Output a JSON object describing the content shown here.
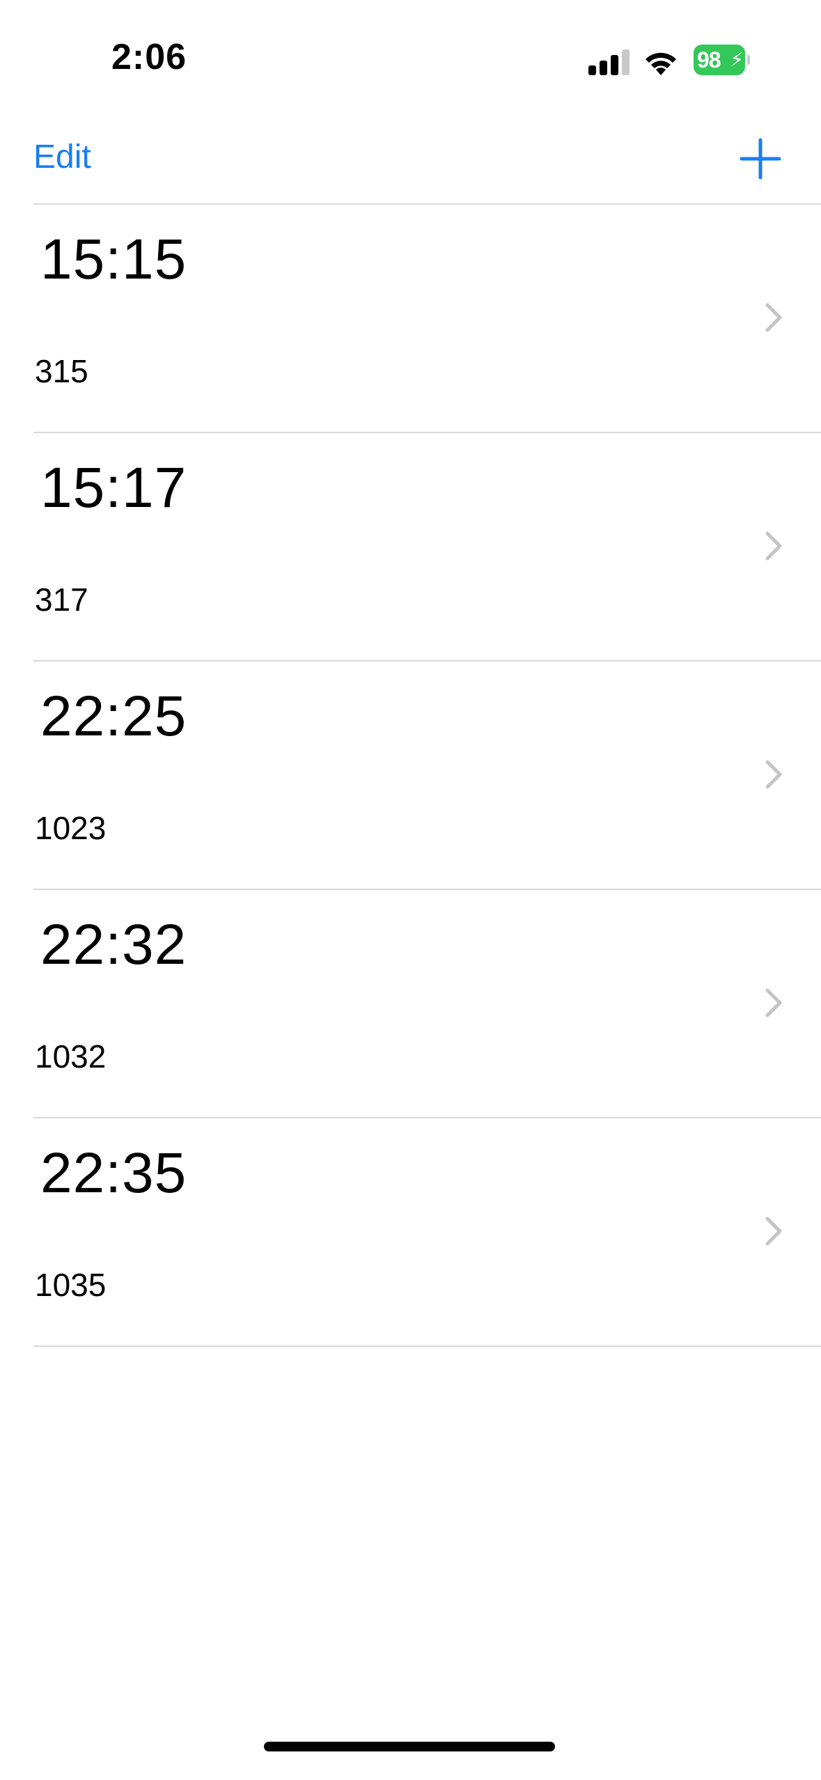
{
  "status_bar": {
    "time": "2:06",
    "battery_level": "98",
    "battery_color": "#34c759"
  },
  "nav": {
    "edit_label": "Edit",
    "add_icon": "plus-icon",
    "accent_color": "#1a7ef2"
  },
  "alarms": [
    {
      "time": "15:15",
      "label": "315"
    },
    {
      "time": "15:17",
      "label": "317"
    },
    {
      "time": "22:25",
      "label": "1023"
    },
    {
      "time": "22:32",
      "label": "1032"
    },
    {
      "time": "22:35",
      "label": "1035"
    }
  ]
}
